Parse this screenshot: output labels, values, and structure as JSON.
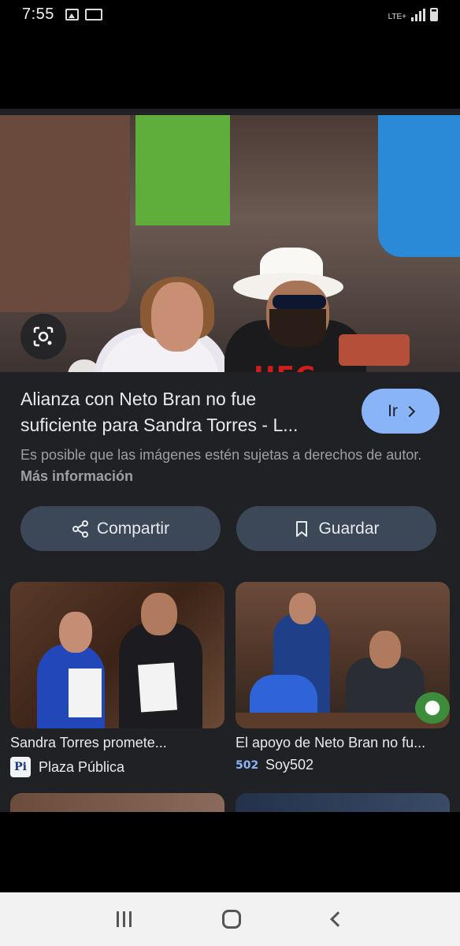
{
  "status_bar": {
    "time": "7:55",
    "network": "LTE+"
  },
  "result": {
    "title_line1": "Alianza con Neto Bran no fue",
    "title_line2": "suficiente para Sandra Torres - L...",
    "visit_label": "Ir",
    "disclaimer_text": "Es posible que las imágenes estén sujetas a derechos de autor.",
    "more_info_label": "Más información",
    "share_label": "Compartir",
    "save_label": "Guardar"
  },
  "related": [
    {
      "title": "Sandra Torres promete...",
      "source": "Plaza Pública",
      "favicon_text": "Pi"
    },
    {
      "title": "El apoyo de Neto Bran no fu...",
      "source": "Soy502",
      "favicon_text": "502"
    }
  ],
  "hero_text": {
    "shirt_text": "UFC"
  },
  "colors": {
    "accent": "#8ab4f8",
    "sheet_bg": "#202124",
    "button_bg": "#3c4858"
  }
}
